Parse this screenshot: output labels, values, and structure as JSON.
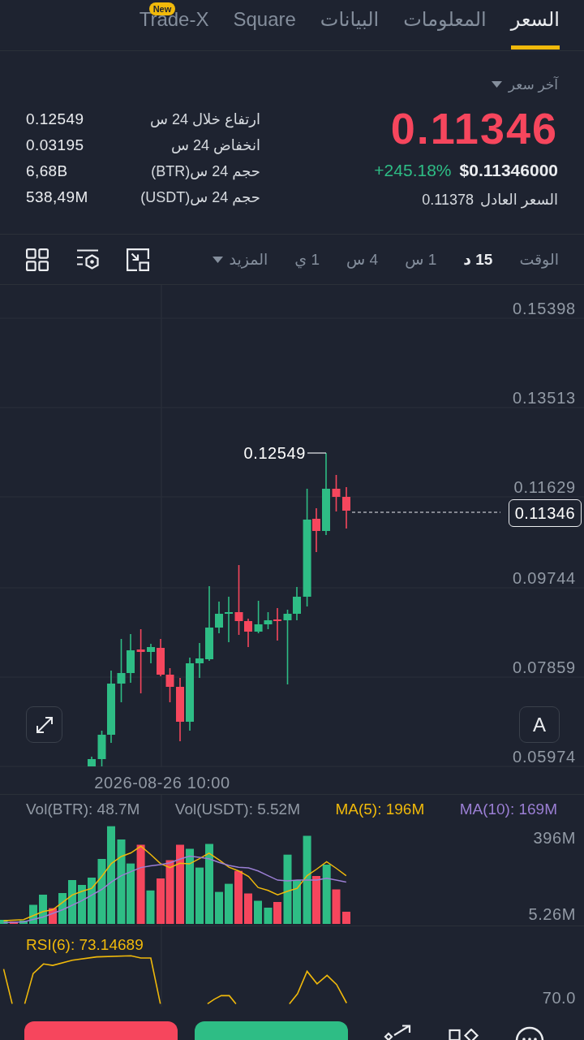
{
  "tabs": [
    {
      "label": "السعر",
      "selected": true
    },
    {
      "label": "المعلومات",
      "selected": false
    },
    {
      "label": "البيانات",
      "selected": false
    },
    {
      "label": "Square",
      "selected": false
    },
    {
      "label": "Trade-X",
      "selected": false,
      "badge": "New"
    }
  ],
  "price": {
    "type_label": "آخر سعر",
    "last_price": "0.11346",
    "last_price_falling": true,
    "usd_price": "$0.11346000",
    "change": "+245.18%",
    "change_positive": true,
    "fair_price_label": "السعر العادل",
    "fair_price": "0.11378"
  },
  "stats": [
    {
      "label": "ارتفاع خلال 24 س",
      "value": "0.12549"
    },
    {
      "label": "انخفاض 24 س",
      "value": "0.03195"
    },
    {
      "label": "حجم 24 س(BTR)",
      "value": "6,68B"
    },
    {
      "label": "حجم 24 س(USDT)",
      "value": "538,49M"
    }
  ],
  "intervals": {
    "label": "الوقت",
    "options": [
      {
        "label": "15 د",
        "selected": true
      },
      {
        "label": "1 س",
        "selected": false
      },
      {
        "label": "4 س",
        "selected": false
      },
      {
        "label": "1 ي",
        "selected": false
      }
    ],
    "more": "المزيد"
  },
  "chart": {
    "y_labels": [
      "0.15398",
      "0.13513",
      "0.11629",
      "0.09744",
      "0.07859",
      "0.05974"
    ],
    "x_label": "2026-08-26 10:00",
    "high_label": "0.12549",
    "price_tag": "0.11346",
    "scale_button": "A"
  },
  "volume": {
    "vol_btr": "Vol(BTR): 48.7M",
    "vol_usdt": "Vol(USDT): 5.52M",
    "ma5": "MA(5): 196M",
    "ma10": "MA(10): 169M",
    "y_labels": [
      "396M",
      "5.26M"
    ]
  },
  "rsi": {
    "label": "RSI(6): 73.14689",
    "y_label": "70.0"
  },
  "action_buttons": [
    {
      "color": "#f6465d"
    },
    {
      "color": "#2ebd85"
    }
  ]
}
